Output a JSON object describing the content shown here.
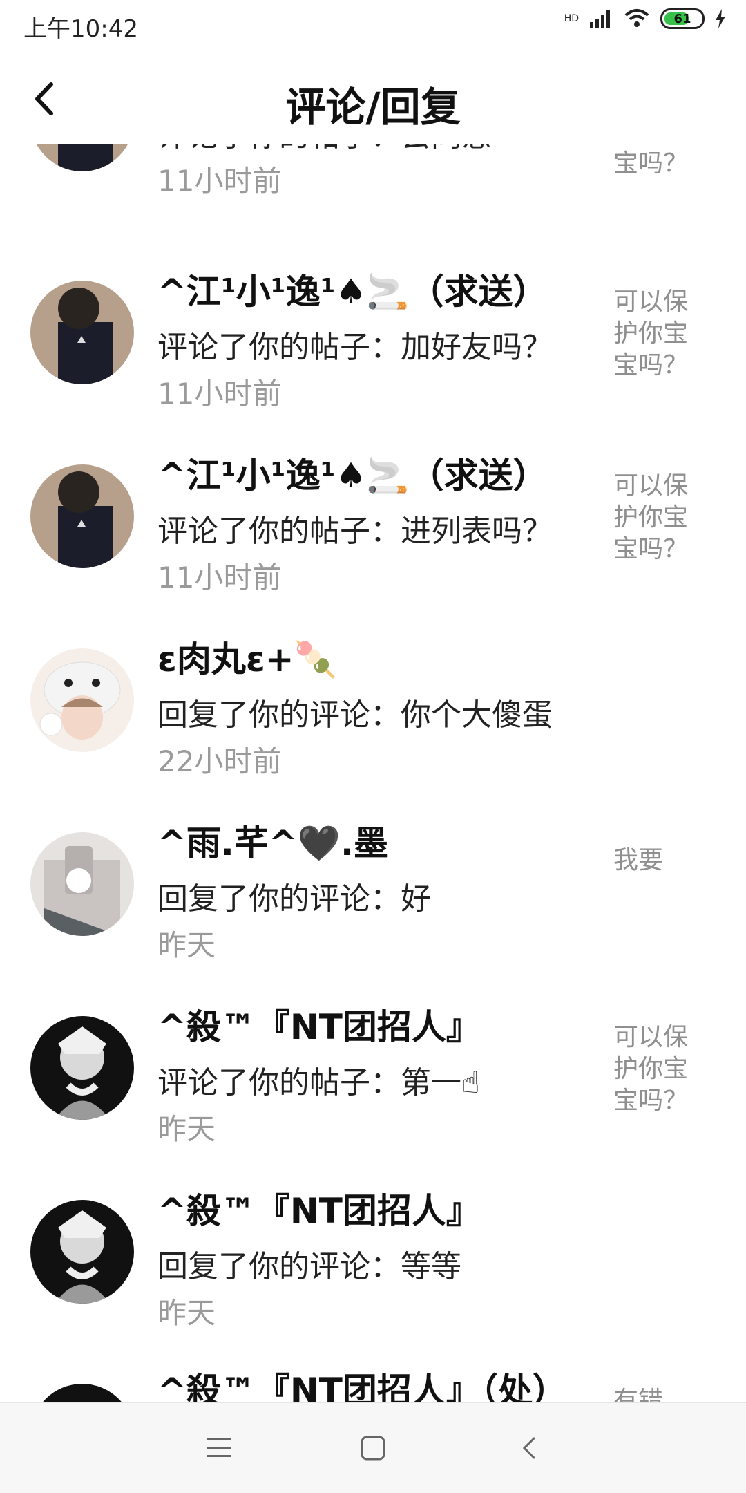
{
  "status": {
    "time": "上午10:42",
    "hd": "HD",
    "battery": "61"
  },
  "header": {
    "title": "评论/回复"
  },
  "items": [
    {
      "name": "",
      "message": "评论了你的帖子：会同意",
      "time": "11小时前",
      "side": "护你宝宝吗？"
    },
    {
      "name": "^江¹小¹逸¹♠🚬（求送）",
      "message": "评论了你的帖子：加好友吗？",
      "time": "11小时前",
      "side": "可以保护你宝宝吗？"
    },
    {
      "name": "^江¹小¹逸¹♠🚬（求送）",
      "message": "评论了你的帖子：进列表吗？",
      "time": "11小时前",
      "side": "可以保护你宝宝吗？"
    },
    {
      "name": "ε肉丸ε+🍡",
      "message": "回复了你的评论：你个大傻蛋",
      "time": "22小时前",
      "side": ""
    },
    {
      "name": "^雨.芊^🖤.墨",
      "message": "回复了你的评论：好",
      "time": "昨天",
      "side": "我要"
    },
    {
      "name": "^殺™『NT团招人』",
      "message": "评论了你的帖子：第一☝",
      "time": "昨天",
      "side": "可以保护你宝宝吗？"
    },
    {
      "name": "^殺™『NT团招人』",
      "message": "回复了你的评论：等等",
      "time": "昨天",
      "side": ""
    },
    {
      "name": "^殺™『NT团招人』（处）",
      "message": "",
      "time": "",
      "side": "有错吧？"
    }
  ]
}
